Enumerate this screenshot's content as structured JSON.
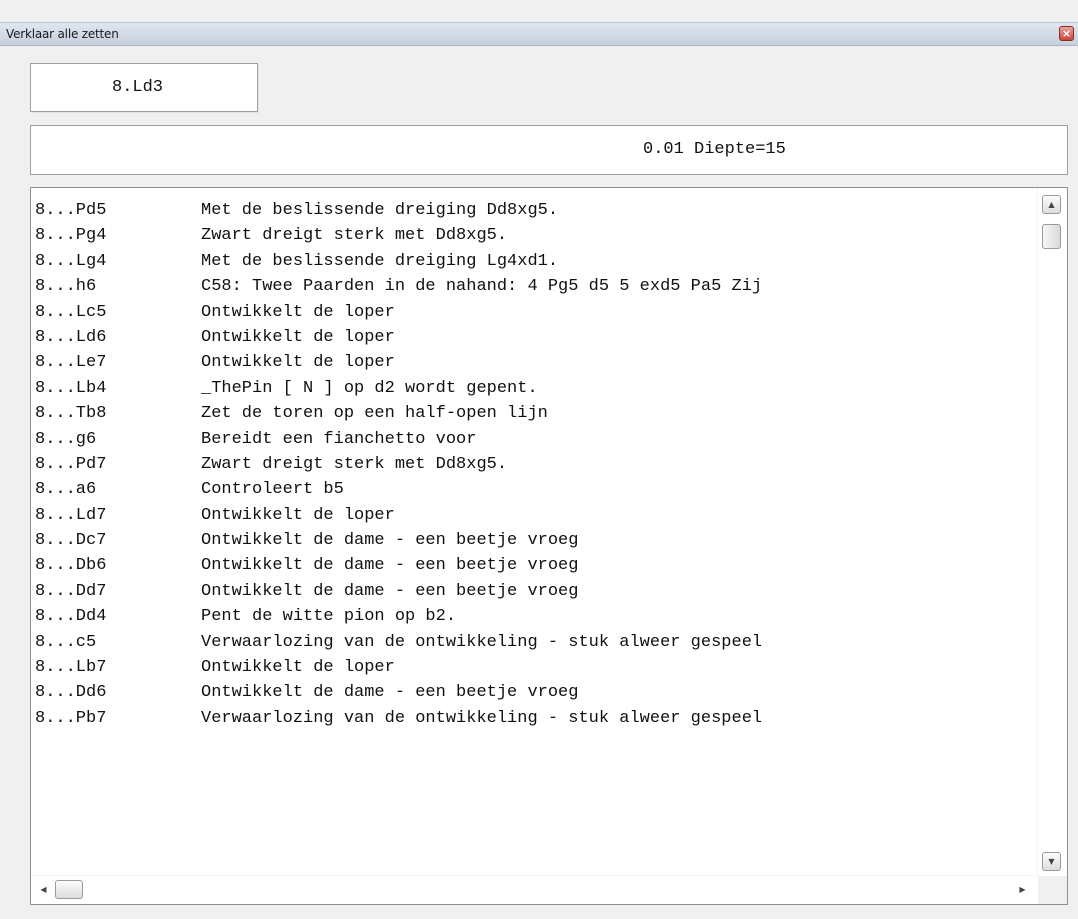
{
  "window": {
    "title": "Verklaar alle zetten",
    "close_symbol": "×"
  },
  "current_move": "8.Ld3",
  "evaluation": "0.01 Diepte=15",
  "moves": [
    {
      "move": "8...Pd5",
      "explanation": "Met de beslissende dreiging Dd8xg5."
    },
    {
      "move": "8...Pg4",
      "explanation": "Zwart dreigt sterk met Dd8xg5."
    },
    {
      "move": "8...Lg4",
      "explanation": "Met de beslissende dreiging Lg4xd1."
    },
    {
      "move": "8...h6",
      "explanation": "C58: Twee Paarden in de nahand: 4 Pg5 d5 5 exd5 Pa5 Zij"
    },
    {
      "move": "8...Lc5",
      "explanation": "Ontwikkelt de loper"
    },
    {
      "move": "8...Ld6",
      "explanation": "Ontwikkelt de loper"
    },
    {
      "move": "8...Le7",
      "explanation": "Ontwikkelt de loper"
    },
    {
      "move": "8...Lb4",
      "explanation": "_ThePin [ N ] op d2 wordt gepent."
    },
    {
      "move": "8...Tb8",
      "explanation": "Zet de toren op een half-open lijn"
    },
    {
      "move": "8...g6",
      "explanation": "Bereidt een fianchetto voor"
    },
    {
      "move": "8...Pd7",
      "explanation": "Zwart dreigt sterk met Dd8xg5."
    },
    {
      "move": "8...a6",
      "explanation": "Controleert b5"
    },
    {
      "move": "8...Ld7",
      "explanation": "Ontwikkelt de loper"
    },
    {
      "move": "8...Dc7",
      "explanation": "Ontwikkelt de dame - een beetje vroeg"
    },
    {
      "move": "8...Db6",
      "explanation": "Ontwikkelt de dame - een beetje vroeg"
    },
    {
      "move": "8...Dd7",
      "explanation": "Ontwikkelt de dame - een beetje vroeg"
    },
    {
      "move": "8...Dd4",
      "explanation": "Pent de witte pion op b2."
    },
    {
      "move": "8...c5",
      "explanation": "Verwaarlozing van de ontwikkeling - stuk alweer gespeel"
    },
    {
      "move": "8...Lb7",
      "explanation": "Ontwikkelt de loper"
    },
    {
      "move": "8...Dd6",
      "explanation": "Ontwikkelt de dame - een beetje vroeg"
    },
    {
      "move": "8...Pb7",
      "explanation": "Verwaarlozing van de ontwikkeling - stuk alweer gespeel"
    }
  ],
  "scrollbars": {
    "up_arrow": "▲",
    "down_arrow": "▼",
    "left_arrow": "◀",
    "right_arrow": "▶"
  }
}
